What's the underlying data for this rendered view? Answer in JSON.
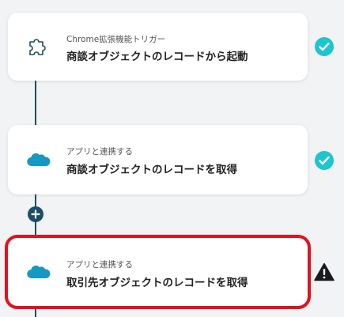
{
  "flow": {
    "steps": [
      {
        "subtitle": "Chrome拡張機能トリガー",
        "title": "商談オブジェクトのレコードから起動",
        "icon": "puzzle-icon",
        "status": "complete"
      },
      {
        "subtitle": "アプリと連携する",
        "title": "商談オブジェクトのレコードを取得",
        "icon": "salesforce-cloud-icon",
        "status": "complete"
      },
      {
        "subtitle": "アプリと連携する",
        "title": "取引先オブジェクトのレコードを取得",
        "icon": "salesforce-cloud-icon",
        "status": "warning"
      }
    ],
    "add_step_icon": "plus-icon"
  },
  "colors": {
    "connector": "#1b4f64",
    "check": "#1cc5cf",
    "salesforce": "#1798c1",
    "highlight": "#e0121f"
  }
}
